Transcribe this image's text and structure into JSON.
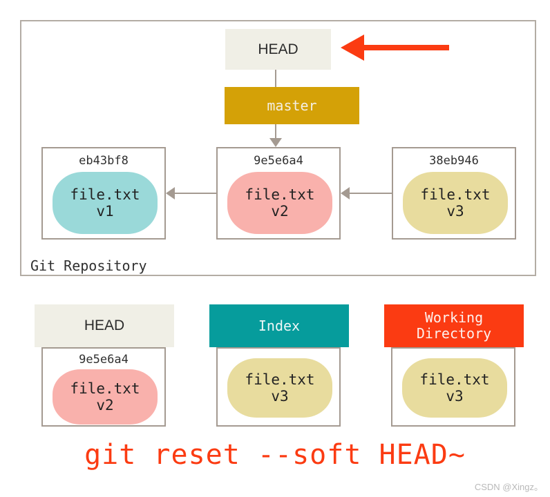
{
  "repository": {
    "label": "Git Repository",
    "head_ref": {
      "label": "HEAD"
    },
    "branch_ref": {
      "label": "master"
    },
    "commits": [
      {
        "hash": "eb43bf8",
        "file": "file.txt",
        "version": "v1",
        "color": "#9ad9d9"
      },
      {
        "hash": "9e5e6a4",
        "file": "file.txt",
        "version": "v2",
        "color": "#f9b1ac"
      },
      {
        "hash": "38eb946",
        "file": "file.txt",
        "version": "v3",
        "color": "#e8dc9e"
      }
    ]
  },
  "areas": [
    {
      "title": "HEAD",
      "title_line2": "",
      "header_bg": "#f0efe6",
      "header_color": "#2b2b2b",
      "header_font": "sans",
      "hash": "9e5e6a4",
      "file": "file.txt",
      "version": "v2",
      "blob_color": "#f9b1ac"
    },
    {
      "title": "Index",
      "title_line2": "",
      "header_bg": "#069c9c",
      "header_color": "#eef7f7",
      "header_font": "mono",
      "hash": "",
      "file": "file.txt",
      "version": "v3",
      "blob_color": "#e8dc9e"
    },
    {
      "title": "Working",
      "title_line2": "Directory",
      "header_bg": "#fb3b12",
      "header_color": "#fdf1ee",
      "header_font": "mono",
      "hash": "",
      "file": "file.txt",
      "version": "v3",
      "blob_color": "#e8dc9e"
    }
  ],
  "command": "git reset --soft HEAD~",
  "watermark": "CSDN @Xingz。",
  "colors": {
    "frame_border": "#b3aca4",
    "box_border": "#a49a91",
    "connector": "#a49a91",
    "accent_red": "#fb3b12",
    "branch_gold": "#d4a107",
    "index_teal": "#069c9c",
    "cream": "#f0efe6"
  }
}
